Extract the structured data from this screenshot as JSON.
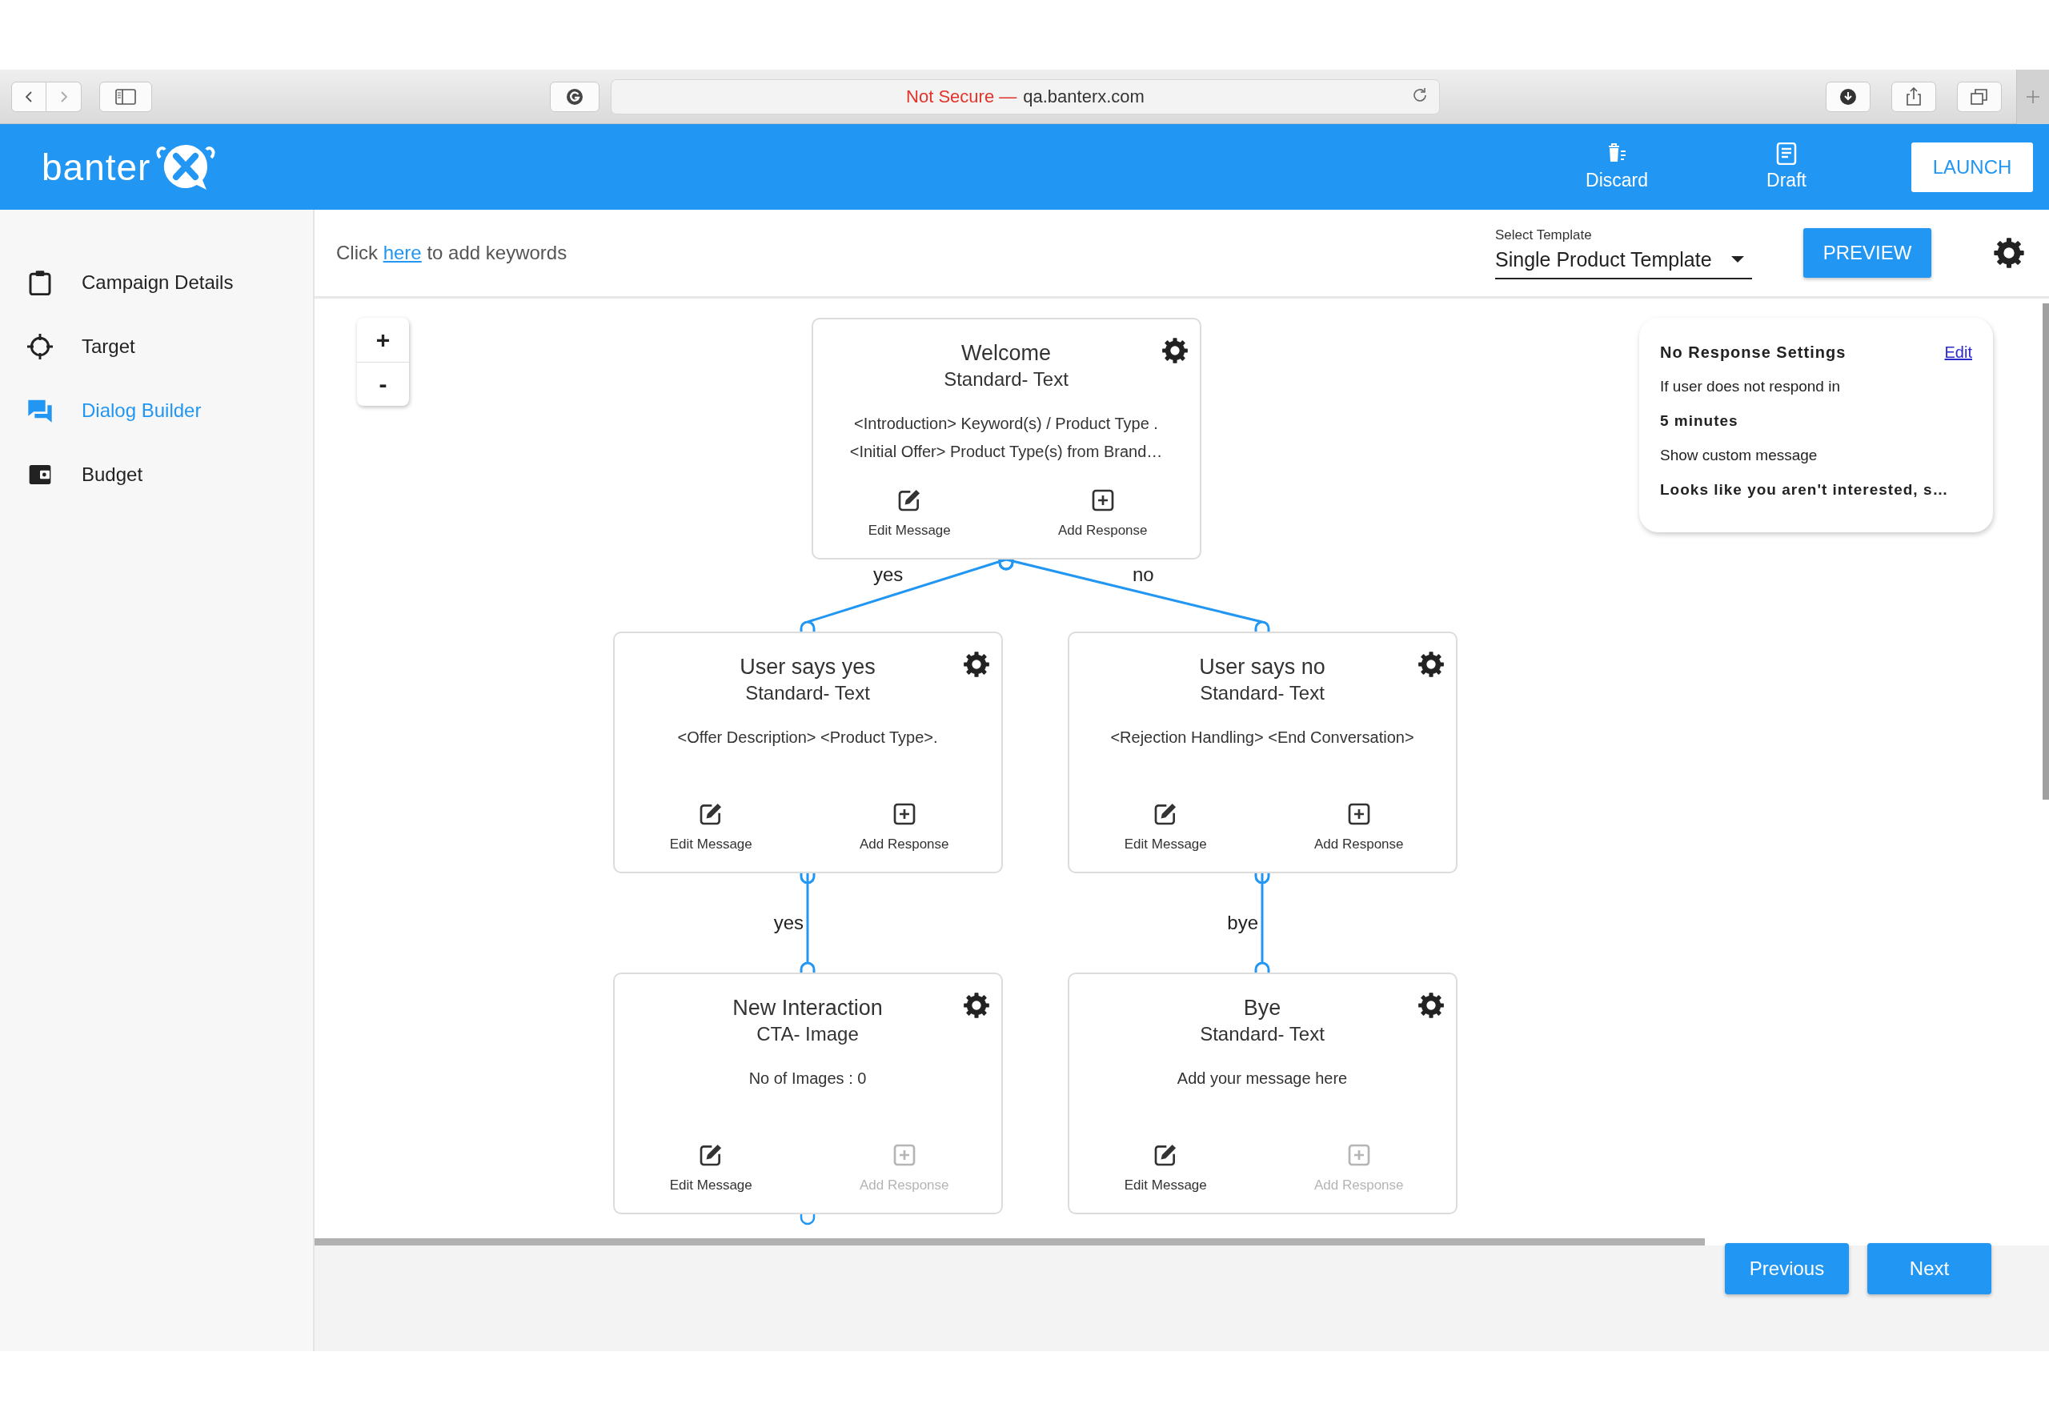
{
  "browser": {
    "security": "Not Secure —",
    "address": "qa.banterx.com"
  },
  "header": {
    "logo": "banter",
    "actions": [
      {
        "label": "Discard"
      },
      {
        "label": "Draft"
      }
    ],
    "launch": "LAUNCH"
  },
  "sidebar": {
    "items": [
      {
        "label": "Campaign Details",
        "selected": false
      },
      {
        "label": "Target",
        "selected": false
      },
      {
        "label": "Dialog Builder",
        "selected": true
      },
      {
        "label": "Budget",
        "selected": false
      }
    ]
  },
  "toolbar": {
    "keywords": {
      "before": "Click",
      "link": "here",
      "after": "to add keywords"
    },
    "template": {
      "label": "Select Template",
      "value": "Single Product Template"
    },
    "preview": "PREVIEW"
  },
  "canvas": {
    "zoom": [
      "+",
      "-"
    ],
    "flow": {
      "title": "Welcome",
      "type": "Standard- Text",
      "lines": [
        "<Introduction> Keyword(s) / Product Type .",
        "<Initial Offer> Product Type(s) from Brand…"
      ],
      "actions": [
        {
          "label": "Edit Message",
          "disabled": false
        },
        {
          "label": "Add Response",
          "disabled": false
        }
      ],
      "open_port": false,
      "children": [
        {
          "edge": "yes",
          "title": "User says yes",
          "type": "Standard- Text",
          "lines": [
            "<Offer Description> <Product Type>."
          ],
          "actions": [
            {
              "label": "Edit Message",
              "disabled": false
            },
            {
              "label": "Add Response",
              "disabled": false
            }
          ],
          "open_port": false,
          "children": [
            {
              "edge": "yes",
              "title": "New Interaction",
              "type": "CTA- Image",
              "lines": [
                "No of Images : 0"
              ],
              "actions": [
                {
                  "label": "Edit Message",
                  "disabled": false
                },
                {
                  "label": "Add Response",
                  "disabled": true
                }
              ],
              "open_port": true
            }
          ]
        },
        {
          "edge": "no",
          "title": "User says no",
          "type": "Standard- Text",
          "lines": [
            "<Rejection Handling> <End Conversation>"
          ],
          "actions": [
            {
              "label": "Edit Message",
              "disabled": false
            },
            {
              "label": "Add Response",
              "disabled": false
            }
          ],
          "open_port": false,
          "children": [
            {
              "edge": "bye",
              "title": "Bye",
              "type": "Standard- Text",
              "lines": [
                "Add your message here"
              ],
              "actions": [
                {
                  "label": "Edit Message",
                  "disabled": false
                },
                {
                  "label": "Add Response",
                  "disabled": true
                }
              ],
              "open_port": false
            }
          ]
        }
      ]
    },
    "no_response": {
      "title": "No Response Settings",
      "edit": "Edit",
      "lines": [
        {
          "text": "If user does not respond in",
          "bold": false
        },
        {
          "text": "5 minutes",
          "bold": true
        },
        {
          "text": "Show custom message",
          "bold": false
        },
        {
          "text": "Looks like you aren't interested, s…",
          "bold": true
        }
      ]
    }
  },
  "footer": {
    "buttons": [
      "Previous",
      "Next"
    ]
  }
}
